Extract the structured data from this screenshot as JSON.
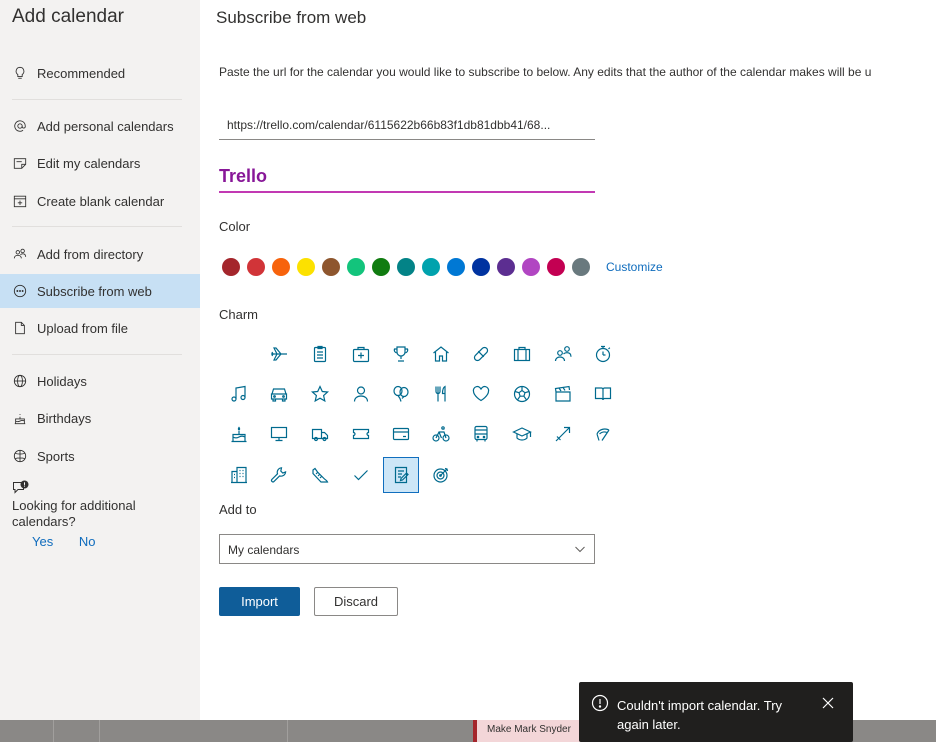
{
  "sidebar": {
    "title": "Add calendar",
    "items": [
      {
        "label": "Recommended",
        "icon": "lightbulb-icon"
      },
      {
        "label": "Add personal calendars",
        "icon": "at-icon"
      },
      {
        "label": "Edit my calendars",
        "icon": "edit-calendar-icon"
      },
      {
        "label": "Create blank calendar",
        "icon": "calendar-add-icon"
      },
      {
        "label": "Add from directory",
        "icon": "people-icon"
      },
      {
        "label": "Subscribe from web",
        "icon": "more-circle-icon",
        "active": true
      },
      {
        "label": "Upload from file",
        "icon": "file-icon"
      },
      {
        "label": "Holidays",
        "icon": "globe-icon"
      },
      {
        "label": "Birthdays",
        "icon": "cake-icon"
      },
      {
        "label": "Sports",
        "icon": "ball-icon"
      }
    ],
    "feedback": {
      "question": "Looking for additional calendars?",
      "yes": "Yes",
      "no": "No"
    }
  },
  "main": {
    "title": "Subscribe from web",
    "description": "Paste the url for the calendar you would like to subscribe to below. Any edits that the author of the calendar makes will be u",
    "url_value": "https://trello.com/calendar/6115622b66b83f1db81dbb41/68...",
    "calendar_name": "Trello",
    "color_label": "Color",
    "colors": [
      "#a4262c",
      "#d13438",
      "#f7630c",
      "#fce100",
      "#8e562e",
      "#13c47c",
      "#107c10",
      "#038387",
      "#00a2ad",
      "#0078d4",
      "#0033a0",
      "#5c2e91",
      "#b146c2",
      "#c30052",
      "#69797e"
    ],
    "customize_label": "Customize",
    "charm_label": "Charm",
    "charms": [
      "airplane-icon",
      "clipboard-icon",
      "first-aid-icon",
      "trophy-icon",
      "home-icon",
      "pill-icon",
      "briefcase-icon",
      "people-icon",
      "stopwatch-icon",
      "music-icon",
      "car-icon",
      "star-icon",
      "person-icon",
      "balloon-icon",
      "utensils-icon",
      "heart-icon",
      "soccer-ball-icon",
      "clapperboard-icon",
      "book-icon",
      "cake-icon",
      "monitor-icon",
      "truck-icon",
      "ticket-icon",
      "credit-card-icon",
      "bicycle-icon",
      "bus-icon",
      "graduation-cap-icon",
      "tag-icon",
      "dumbbell-icon",
      "beach-icon",
      "building-icon",
      "wrench-icon",
      "shoe-icon",
      "checkmark-icon",
      "notepad-icon",
      "target-icon"
    ],
    "selected_charm": "notepad-icon",
    "add_to_label": "Add to",
    "add_to_value": "My calendars",
    "import_label": "Import",
    "discard_label": "Discard"
  },
  "background_event": "Make Mark Snyder",
  "toast": {
    "message": "Couldn't import calendar. Try again later."
  }
}
